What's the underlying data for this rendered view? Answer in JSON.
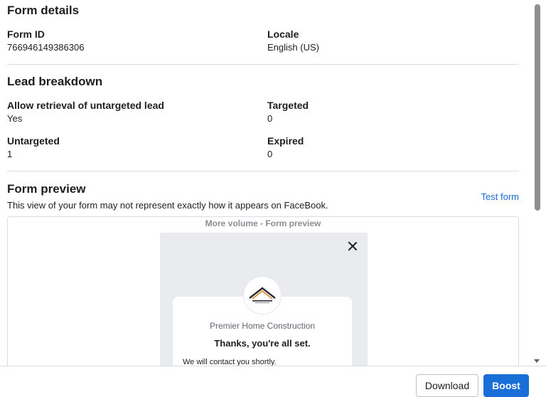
{
  "form_details": {
    "title": "Form details",
    "form_id_label": "Form ID",
    "form_id_value": "766946149386306",
    "locale_label": "Locale",
    "locale_value": "English (US)"
  },
  "lead_breakdown": {
    "title": "Lead breakdown",
    "allow_retrieval_label": "Allow retrieval of untargeted lead",
    "allow_retrieval_value": "Yes",
    "targeted_label": "Targeted",
    "targeted_value": "0",
    "untargeted_label": "Untargeted",
    "untargeted_value": "1",
    "expired_label": "Expired",
    "expired_value": "0"
  },
  "form_preview": {
    "title": "Form preview",
    "description": "This view of your form may not represent exactly how it appears on FaceBook.",
    "test_form_link": "Test form",
    "preview_title": "More volume - Form preview",
    "business_name": "Premier Home Construction",
    "thanks_heading": "Thanks, you're all set.",
    "contact_text": "We will contact you shortly.",
    "logo_icon": "house-roof-logo"
  },
  "footer": {
    "download_label": "Download",
    "boost_label": "Boost"
  },
  "colors": {
    "accent": "#1a6ed8",
    "divider": "#dadde1",
    "preview_bg": "#e9ebee"
  }
}
